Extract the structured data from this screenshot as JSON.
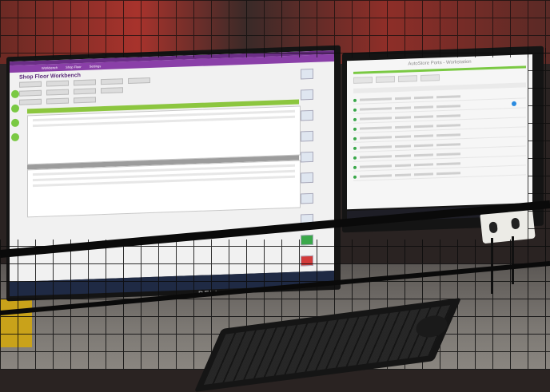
{
  "left_monitor": {
    "brand": "DELL",
    "app": {
      "menu_items": [
        "Workbench",
        "Shop Floor",
        "Settings"
      ],
      "title": "Shop Floor Workbench"
    }
  },
  "right_monitor": {
    "app": {
      "header": "AutoStore Ports - Workstation"
    }
  }
}
